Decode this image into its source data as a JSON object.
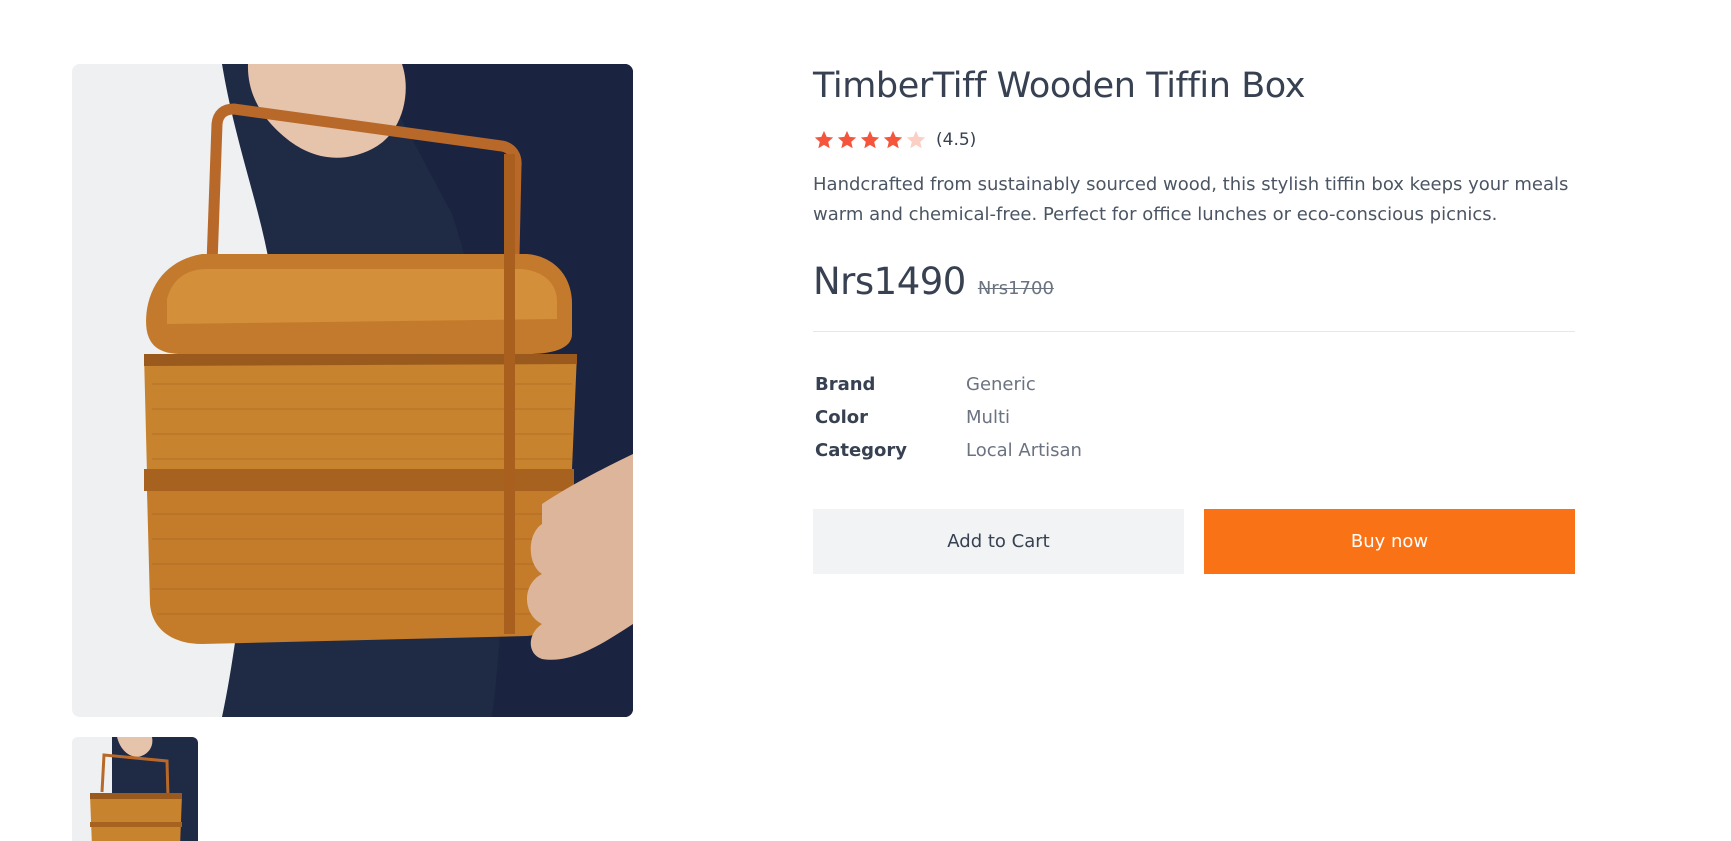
{
  "product": {
    "title": "TimberTiff Wooden Tiffin Box",
    "rating_value": 4.5,
    "rating_text": "(4.5)",
    "description": "Handcrafted from sustainably sourced wood, this stylish tiffin box keeps your meals warm and chemical-free. Perfect for office lunches or eco-conscious picnics.",
    "price": "Nrs1490",
    "old_price": "Nrs1700"
  },
  "specs": [
    {
      "label": "Brand",
      "value": "Generic"
    },
    {
      "label": "Color",
      "value": "Multi"
    },
    {
      "label": "Category",
      "value": "Local Artisan"
    }
  ],
  "actions": {
    "add_to_cart_label": "Add to Cart",
    "buy_now_label": "Buy now"
  },
  "colors": {
    "star_filled": "#f4553b",
    "star_empty": "#fbcfc4",
    "accent": "#f97316",
    "text": "#374151"
  },
  "icons": {
    "star": "star-icon"
  }
}
